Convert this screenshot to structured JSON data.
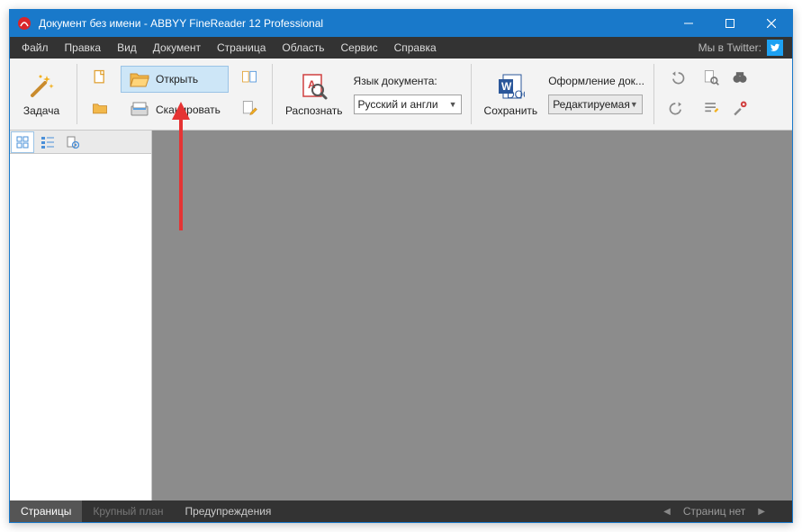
{
  "title": "Документ без имени - ABBYY FineReader 12 Professional",
  "menu": {
    "file": "Файл",
    "edit": "Правка",
    "view": "Вид",
    "document": "Документ",
    "page": "Страница",
    "area": "Область",
    "service": "Сервис",
    "help": "Справка",
    "twitter": "Мы в Twitter:"
  },
  "ribbon": {
    "task": "Задача",
    "open": "Открыть",
    "scan": "Сканировать",
    "recognize": "Распознать",
    "lang_label": "Язык документа:",
    "lang_value": "Русский и англи",
    "save": "Сохранить",
    "design_label": "Оформление док...",
    "design_value": "Редактируемая"
  },
  "status": {
    "pages": "Страницы",
    "close": "Крупный план",
    "warnings": "Предупреждения",
    "nopages": "Страниц нет"
  }
}
